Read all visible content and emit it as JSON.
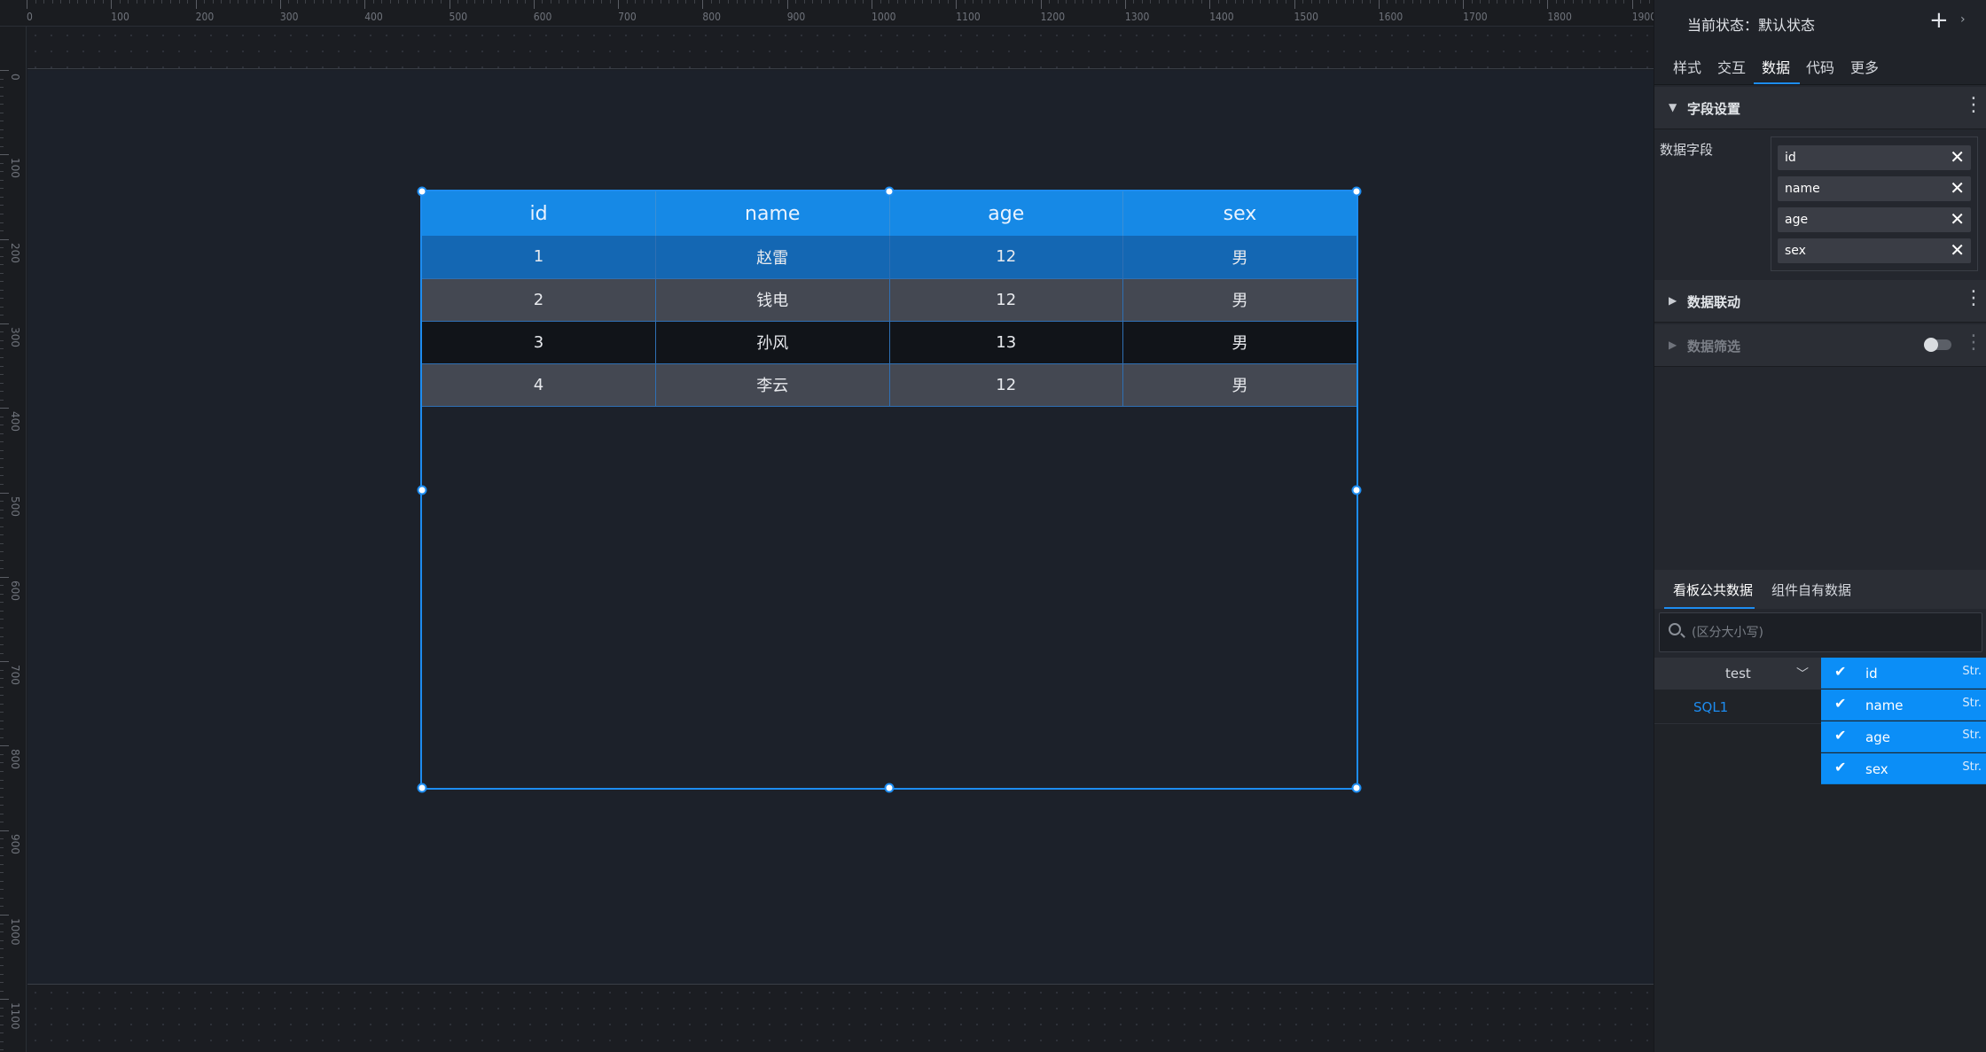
{
  "ruler": {
    "top_labels": [
      "0",
      "100",
      "200",
      "300",
      "400",
      "500",
      "600",
      "700",
      "800",
      "900",
      "1000",
      "1100",
      "1200",
      "1300",
      "1400",
      "1500",
      "1600",
      "1700",
      "1800",
      "1900"
    ],
    "left_labels": [
      "0",
      "100",
      "200",
      "300",
      "400",
      "500",
      "600",
      "700",
      "800",
      "900",
      "1000",
      "1100"
    ]
  },
  "table": {
    "headers": [
      "id",
      "name",
      "age",
      "sex"
    ],
    "rows": [
      [
        "1",
        "赵雷",
        "12",
        "男"
      ],
      [
        "2",
        "钱电",
        "12",
        "男"
      ],
      [
        "3",
        "孙风",
        "13",
        "男"
      ],
      [
        "4",
        "李云",
        "12",
        "男"
      ]
    ]
  },
  "panel": {
    "state_label": "当前状态：默认状态",
    "add_icon": "plus-icon",
    "tabs": [
      "样式",
      "交互",
      "数据",
      "代码",
      "更多"
    ],
    "active_tab": "数据",
    "field_settings": {
      "title": "字段设置",
      "label": "数据字段",
      "fields": [
        "id",
        "name",
        "age",
        "sex"
      ]
    },
    "data_link": {
      "title": "数据联动"
    },
    "data_filter": {
      "title": "数据筛选",
      "enabled": false
    },
    "source_tabs": [
      "看板公共数据",
      "组件自有数据"
    ],
    "search": {
      "placeholder": "(区分大小写)",
      "value": ""
    },
    "dataset": {
      "name": "test",
      "items": [
        "SQL1"
      ]
    },
    "columns": [
      {
        "name": "id",
        "type": "Str.",
        "checked": true
      },
      {
        "name": "name",
        "type": "Str.",
        "checked": true
      },
      {
        "name": "age",
        "type": "Str.",
        "checked": true
      },
      {
        "name": "sex",
        "type": "Str.",
        "checked": true
      }
    ],
    "colors": {
      "accent": "#1d8cf0",
      "header_bg": "#1689e6",
      "selected_row": "#1467b3"
    }
  }
}
